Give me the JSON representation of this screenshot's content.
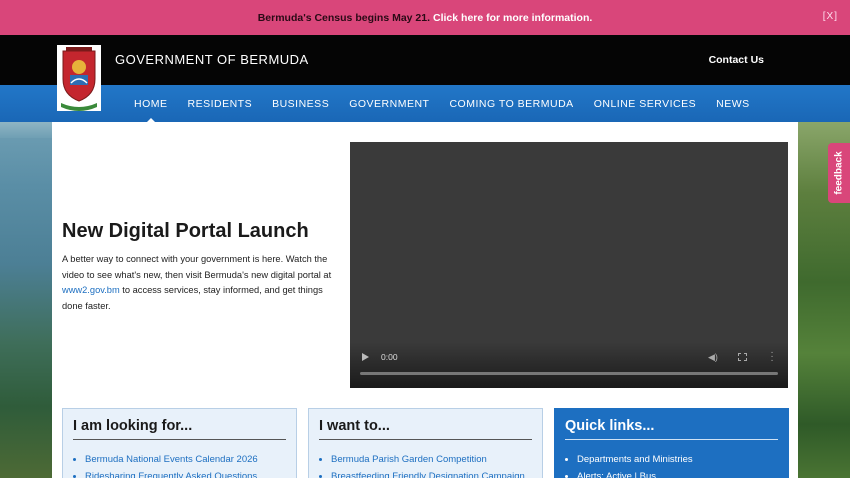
{
  "alert": {
    "lead": "Bermuda's Census begins May 21.",
    "link": "Click here for more information.",
    "close": "[X]"
  },
  "header": {
    "title": "GOVERNMENT OF BERMUDA",
    "contact": "Contact Us"
  },
  "nav": {
    "items": [
      "HOME",
      "RESIDENTS",
      "BUSINESS",
      "GOVERNMENT",
      "COMING TO BERMUDA",
      "ONLINE SERVICES",
      "NEWS"
    ],
    "active": "HOME"
  },
  "hero": {
    "title": "New Digital Portal Launch",
    "text_before": "A better way to connect with your government is here. Watch the video to see what's new, then visit Bermuda's new digital portal at ",
    "link": "www2.gov.bm",
    "text_after": " to access services, stay informed, and get things done faster."
  },
  "video": {
    "time": "0:00"
  },
  "feedback": "feedback",
  "cards": {
    "looking": {
      "title": "I am looking for...",
      "items": [
        "Bermuda National Events Calendar 2026",
        "Ridesharing Frequently Asked Questions"
      ]
    },
    "want": {
      "title": "I want to...",
      "items": [
        "Bermuda Parish Garden Competition",
        "Breastfeeding Friendly Designation Campaign"
      ]
    },
    "quick": {
      "title": "Quick links...",
      "items": [
        "Departments and Ministries",
        "Alerts: Active | Bus"
      ]
    }
  },
  "colors": {
    "alert_bg": "#d9467a",
    "nav_bg": "#1d6fc1",
    "header_bg": "#050505",
    "link": "#1d6fc1"
  }
}
